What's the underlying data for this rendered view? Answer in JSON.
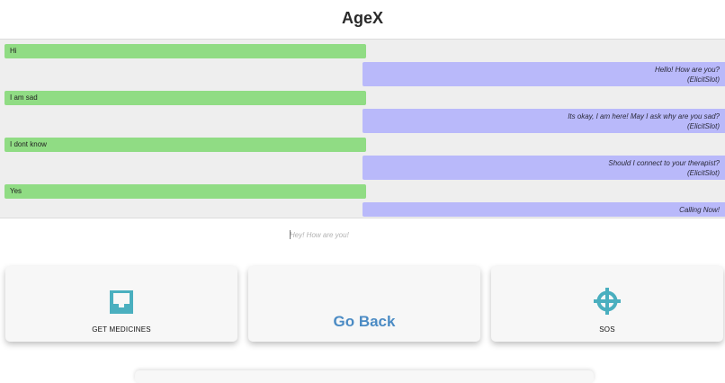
{
  "app": {
    "title": "AgeX"
  },
  "conversation": {
    "messages": [
      {
        "from": "user",
        "text": "Hi"
      },
      {
        "from": "bot",
        "text": "Hello! How are you?",
        "slot": "(ElicitSlot)"
      },
      {
        "from": "user",
        "text": "I am sad"
      },
      {
        "from": "bot",
        "text": "Its okay, I am here! May I ask why are you sad?",
        "slot": "(ElicitSlot)"
      },
      {
        "from": "user",
        "text": "I dont know"
      },
      {
        "from": "bot",
        "text": "Should I connect to your therapist?",
        "slot": "(ElicitSlot)"
      },
      {
        "from": "user",
        "text": "Yes"
      },
      {
        "from": "bot",
        "text": "Calling Now!"
      }
    ]
  },
  "input": {
    "placeholder": "Hey! How are you!"
  },
  "actions": {
    "medicines_label": "GET MEDICINES",
    "medicines_icon": "inbox-tray-icon",
    "go_back_label": "Go Back",
    "sos_label": "SOS",
    "sos_icon": "crosshair-icon"
  },
  "colors": {
    "user_bubble": "#90dc84",
    "bot_bubble": "#b9b9fa",
    "icon_teal": "#4aafbf",
    "go_back_blue": "#4b8bc4"
  }
}
